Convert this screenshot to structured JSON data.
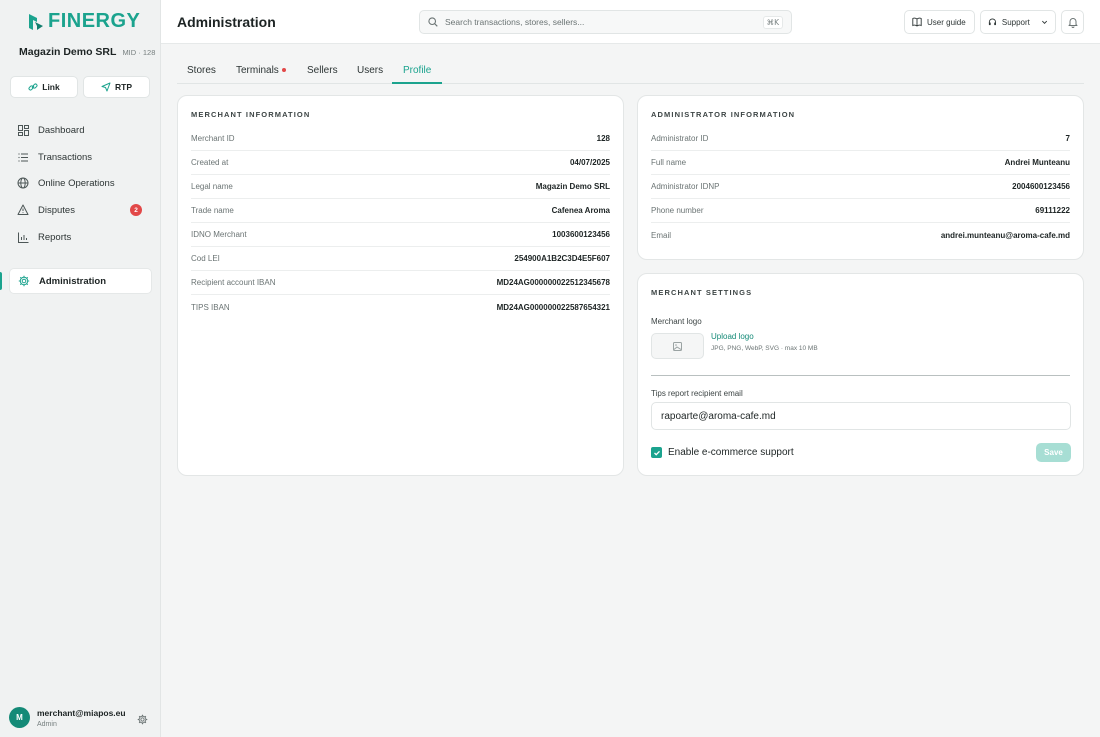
{
  "brand": {
    "name": "FINERGY",
    "accent": "#1ba38e"
  },
  "merchant": {
    "name": "Magazin Demo SRL",
    "mid": "MID · 128"
  },
  "quick_actions": {
    "link": "Link",
    "rtp": "RTP"
  },
  "nav": {
    "dashboard": "Dashboard",
    "transactions": "Transactions",
    "online_operations": "Online Operations",
    "disputes": "Disputes",
    "disputes_badge": "2",
    "reports": "Reports",
    "administration": "Administration"
  },
  "user": {
    "initial": "M",
    "email": "merchant@miapos.eu",
    "role": "Admin"
  },
  "header": {
    "title": "Administration",
    "search_placeholder": "Search transactions, stores, sellers...",
    "search_shortcut": "⌘K",
    "user_guide": "User guide",
    "support": "Support"
  },
  "tabs": {
    "stores": "Stores",
    "terminals": "Terminals",
    "sellers": "Sellers",
    "users": "Users",
    "profile": "Profile"
  },
  "merchant_info": {
    "title": "MERCHANT INFORMATION",
    "rows": [
      {
        "k": "Merchant ID",
        "v": "128"
      },
      {
        "k": "Created at",
        "v": "04/07/2025"
      },
      {
        "k": "Legal name",
        "v": "Magazin Demo SRL"
      },
      {
        "k": "Trade name",
        "v": "Cafenea Aroma"
      },
      {
        "k": "IDNO Merchant",
        "v": "1003600123456"
      },
      {
        "k": "Cod LEI",
        "v": "254900A1B2C3D4E5F607"
      },
      {
        "k": "Recipient account IBAN",
        "v": "MD24AG000000022512345678"
      },
      {
        "k": "TIPS IBAN",
        "v": "MD24AG000000022587654321"
      }
    ]
  },
  "admin_info": {
    "title": "ADMINISTRATOR INFORMATION",
    "rows": [
      {
        "k": "Administrator ID",
        "v": "7"
      },
      {
        "k": "Full name",
        "v": "Andrei Munteanu"
      },
      {
        "k": "Administrator IDNP",
        "v": "2004600123456"
      },
      {
        "k": "Phone number",
        "v": "69111222"
      },
      {
        "k": "Email",
        "v": "andrei.munteanu@aroma-cafe.md"
      }
    ]
  },
  "settings": {
    "title": "MERCHANT SETTINGS",
    "logo_label": "Merchant logo",
    "upload_link": "Upload logo",
    "upload_hint": "JPG, PNG, WebP, SVG · max 10 MB",
    "tips_label": "Tips report recipient email",
    "tips_email": "rapoarte@aroma-cafe.md",
    "ecommerce_label": "Enable e-commerce support",
    "ecommerce_checked": true,
    "save": "Save"
  }
}
